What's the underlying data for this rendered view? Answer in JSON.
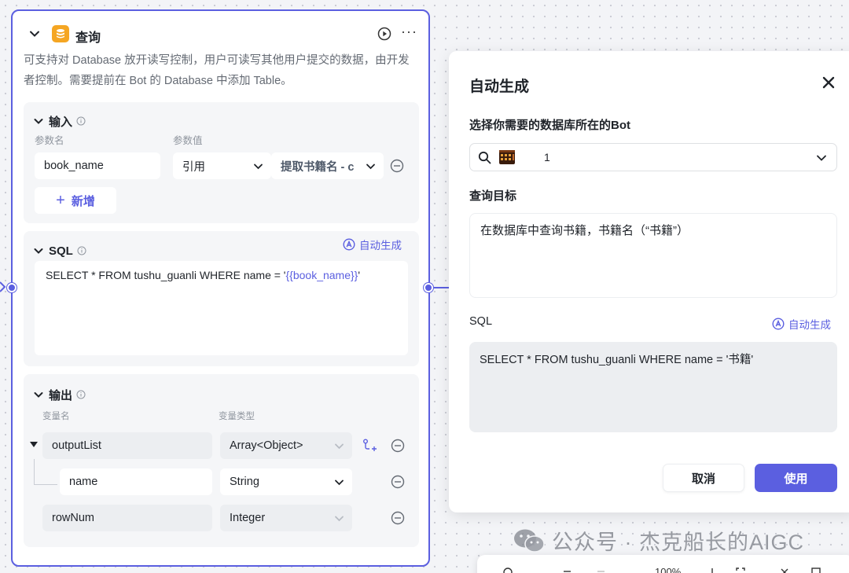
{
  "node": {
    "title": "查询",
    "description": "可支持对 Database 放开读写控制，用户可读写其他用户提交的数据，由开发者控制。需要提前在 Bot 的 Database 中添加 Table。",
    "more": "···"
  },
  "input": {
    "title": "输入",
    "param_name_label": "参数名",
    "param_value_label": "参数值",
    "rows": [
      {
        "name": "book_name",
        "type": "引用",
        "value": "提取书籍名 - c"
      }
    ],
    "add_label": "新增"
  },
  "sql": {
    "title": "SQL",
    "auto_label": "自动生成",
    "query_prefix": "SELECT * FROM tushu_guanli WHERE name = '",
    "query_var": "{{book_name}}",
    "query_suffix": "'"
  },
  "output": {
    "title": "输出",
    "var_name_label": "变量名",
    "var_type_label": "变量类型",
    "rows": [
      {
        "name": "outputList",
        "type": "Array<Object>"
      },
      {
        "name": "name",
        "type": "String"
      },
      {
        "name": "rowNum",
        "type": "Integer"
      }
    ]
  },
  "modal": {
    "title": "自动生成",
    "bot_label": "选择你需要的数据库所在的Bot",
    "bot_value": "1",
    "target_label": "查询目标",
    "target_value": "在数据库中查询书籍，书籍名（“书籍”）",
    "sql_label": "SQL",
    "auto_label": "自动生成",
    "sql_value": "SELECT * FROM tushu_guanli WHERE name = '书籍'",
    "cancel_label": "取消",
    "use_label": "使用"
  },
  "watermark": {
    "text": "公众号 · 杰克船长的AIGC"
  },
  "toolbar": {
    "zoom": "100%"
  },
  "colors": {
    "accent": "#5b5fe0",
    "db_icon": "#f5a623",
    "panel_bg": "#f5f6f8"
  }
}
